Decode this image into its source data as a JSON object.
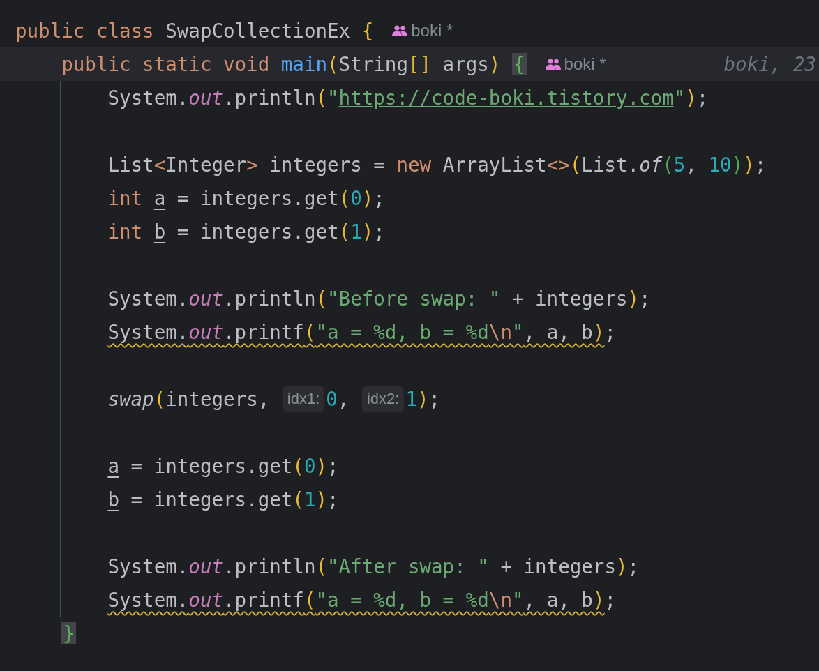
{
  "editor": {
    "lines": [
      {
        "current": false,
        "tokens": [
          {
            "kind": "keyword",
            "text": "public class "
          },
          {
            "kind": "plain",
            "text": "SwapCollectionEx "
          },
          {
            "kind": "paren",
            "text": "{"
          },
          {
            "kind": "author",
            "text": "boki *"
          }
        ],
        "children": [
          {
            "current": true,
            "tokens": [
              {
                "kind": "keyword",
                "text": "public static void "
              },
              {
                "kind": "method",
                "text": "main"
              },
              {
                "kind": "paren",
                "text": "("
              },
              {
                "kind": "plain",
                "text": "String"
              },
              {
                "kind": "paren",
                "text": "[]"
              },
              {
                "kind": "plain",
                "text": " args"
              },
              {
                "kind": "paren",
                "text": ") "
              },
              {
                "kind": "brace-match",
                "text": "{"
              },
              {
                "kind": "author",
                "text": "boki *"
              },
              {
                "kind": "blame",
                "text": "boki, 23"
              }
            ],
            "children": [
              {
                "current": false,
                "tokens": [
                  {
                    "kind": "plain",
                    "text": "System."
                  },
                  {
                    "kind": "field",
                    "text": "out"
                  },
                  {
                    "kind": "plain",
                    "text": ".println"
                  },
                  {
                    "kind": "paren",
                    "text": "("
                  },
                  {
                    "kind": "string",
                    "text": "\""
                  },
                  {
                    "kind": "link",
                    "text": "https://code-boki.tistory.com"
                  },
                  {
                    "kind": "string",
                    "text": "\""
                  },
                  {
                    "kind": "paren",
                    "text": ")"
                  },
                  {
                    "kind": "plain",
                    "text": ";"
                  }
                ]
              },
              {
                "current": false
              },
              {
                "current": false,
                "tokens": [
                  {
                    "kind": "plain",
                    "text": "List"
                  },
                  {
                    "kind": "keyword",
                    "text": "<"
                  },
                  {
                    "kind": "plain",
                    "text": "Integer"
                  },
                  {
                    "kind": "keyword",
                    "text": ">"
                  },
                  {
                    "kind": "plain",
                    "text": " integers = "
                  },
                  {
                    "kind": "keyword",
                    "text": "new "
                  },
                  {
                    "kind": "plain",
                    "text": "ArrayList"
                  },
                  {
                    "kind": "keyword",
                    "text": "<>"
                  },
                  {
                    "kind": "paren",
                    "text": "("
                  },
                  {
                    "kind": "plain",
                    "text": "List."
                  },
                  {
                    "kind": "static-call",
                    "text": "of"
                  },
                  {
                    "kind": "paren2",
                    "text": "("
                  },
                  {
                    "kind": "number",
                    "text": "5"
                  },
                  {
                    "kind": "plain",
                    "text": ", "
                  },
                  {
                    "kind": "number",
                    "text": "10"
                  },
                  {
                    "kind": "paren2",
                    "text": ")"
                  },
                  {
                    "kind": "paren",
                    "text": ")"
                  },
                  {
                    "kind": "plain",
                    "text": ";"
                  }
                ]
              },
              {
                "current": false,
                "tokens": [
                  {
                    "kind": "keyword",
                    "text": "int "
                  },
                  {
                    "kind": "var",
                    "text": "a"
                  },
                  {
                    "kind": "plain",
                    "text": " = integers.get"
                  },
                  {
                    "kind": "paren",
                    "text": "("
                  },
                  {
                    "kind": "number",
                    "text": "0"
                  },
                  {
                    "kind": "paren",
                    "text": ")"
                  },
                  {
                    "kind": "plain",
                    "text": ";"
                  }
                ]
              },
              {
                "current": false,
                "tokens": [
                  {
                    "kind": "keyword",
                    "text": "int "
                  },
                  {
                    "kind": "var",
                    "text": "b"
                  },
                  {
                    "kind": "plain",
                    "text": " = integers.get"
                  },
                  {
                    "kind": "paren",
                    "text": "("
                  },
                  {
                    "kind": "number",
                    "text": "1"
                  },
                  {
                    "kind": "paren",
                    "text": ")"
                  },
                  {
                    "kind": "plain",
                    "text": ";"
                  }
                ]
              },
              {
                "current": false
              },
              {
                "current": false,
                "tokens": [
                  {
                    "kind": "plain",
                    "text": "System."
                  },
                  {
                    "kind": "field",
                    "text": "out"
                  },
                  {
                    "kind": "plain",
                    "text": ".println"
                  },
                  {
                    "kind": "paren",
                    "text": "("
                  },
                  {
                    "kind": "string",
                    "text": "\"Before swap: \""
                  },
                  {
                    "kind": "plain",
                    "text": " + integers"
                  },
                  {
                    "kind": "paren",
                    "text": ")"
                  },
                  {
                    "kind": "plain",
                    "text": ";"
                  }
                ]
              },
              {
                "current": false,
                "tokens": [
                  {
                    "kind": "warning",
                    "tokens": [
                      {
                        "kind": "plain",
                        "text": "System."
                      },
                      {
                        "kind": "field",
                        "text": "out"
                      },
                      {
                        "kind": "plain",
                        "text": ".printf"
                      },
                      {
                        "kind": "paren",
                        "text": "("
                      },
                      {
                        "kind": "string",
                        "text": "\"a = %d, b = %d"
                      },
                      {
                        "kind": "escape",
                        "text": "\\n"
                      },
                      {
                        "kind": "string",
                        "text": "\""
                      },
                      {
                        "kind": "plain",
                        "text": ", a, b"
                      },
                      {
                        "kind": "paren",
                        "text": ")"
                      }
                    ]
                  },
                  {
                    "kind": "plain",
                    "text": ";"
                  }
                ]
              },
              {
                "current": false
              },
              {
                "current": false,
                "tokens": [
                  {
                    "kind": "static-call",
                    "text": "swap"
                  },
                  {
                    "kind": "paren",
                    "text": "("
                  },
                  {
                    "kind": "plain",
                    "text": "integers, "
                  },
                  {
                    "kind": "hint",
                    "text": "idx1:"
                  },
                  {
                    "kind": "number",
                    "text": "0"
                  },
                  {
                    "kind": "plain",
                    "text": ", "
                  },
                  {
                    "kind": "hint",
                    "text": "idx2:"
                  },
                  {
                    "kind": "number",
                    "text": "1"
                  },
                  {
                    "kind": "paren",
                    "text": ")"
                  },
                  {
                    "kind": "plain",
                    "text": ";"
                  }
                ]
              },
              {
                "current": false
              },
              {
                "current": false,
                "tokens": [
                  {
                    "kind": "var",
                    "text": "a"
                  },
                  {
                    "kind": "plain",
                    "text": " = integers.get"
                  },
                  {
                    "kind": "paren",
                    "text": "("
                  },
                  {
                    "kind": "number",
                    "text": "0"
                  },
                  {
                    "kind": "paren",
                    "text": ")"
                  },
                  {
                    "kind": "plain",
                    "text": ";"
                  }
                ]
              },
              {
                "current": false,
                "tokens": [
                  {
                    "kind": "var",
                    "text": "b"
                  },
                  {
                    "kind": "plain",
                    "text": " = integers.get"
                  },
                  {
                    "kind": "paren",
                    "text": "("
                  },
                  {
                    "kind": "number",
                    "text": "1"
                  },
                  {
                    "kind": "paren",
                    "text": ")"
                  },
                  {
                    "kind": "plain",
                    "text": ";"
                  }
                ]
              },
              {
                "current": false
              },
              {
                "current": false,
                "tokens": [
                  {
                    "kind": "plain",
                    "text": "System."
                  },
                  {
                    "kind": "field",
                    "text": "out"
                  },
                  {
                    "kind": "plain",
                    "text": ".println"
                  },
                  {
                    "kind": "paren",
                    "text": "("
                  },
                  {
                    "kind": "string",
                    "text": "\"After swap: \""
                  },
                  {
                    "kind": "plain",
                    "text": " + integers"
                  },
                  {
                    "kind": "paren",
                    "text": ")"
                  },
                  {
                    "kind": "plain",
                    "text": ";"
                  }
                ]
              },
              {
                "current": false,
                "tokens": [
                  {
                    "kind": "warning",
                    "tokens": [
                      {
                        "kind": "plain",
                        "text": "System."
                      },
                      {
                        "kind": "field",
                        "text": "out"
                      },
                      {
                        "kind": "plain",
                        "text": ".printf"
                      },
                      {
                        "kind": "paren",
                        "text": "("
                      },
                      {
                        "kind": "string",
                        "text": "\"a = %d, b = %d"
                      },
                      {
                        "kind": "escape",
                        "text": "\\n"
                      },
                      {
                        "kind": "string",
                        "text": "\""
                      },
                      {
                        "kind": "plain",
                        "text": ", a, b"
                      },
                      {
                        "kind": "paren",
                        "text": ")"
                      }
                    ]
                  },
                  {
                    "kind": "plain",
                    "text": ";"
                  }
                ]
              }
            ]
          },
          {
            "current": false,
            "tokens": [
              {
                "kind": "brace-match",
                "text": "}"
              }
            ]
          }
        ]
      }
    ]
  }
}
